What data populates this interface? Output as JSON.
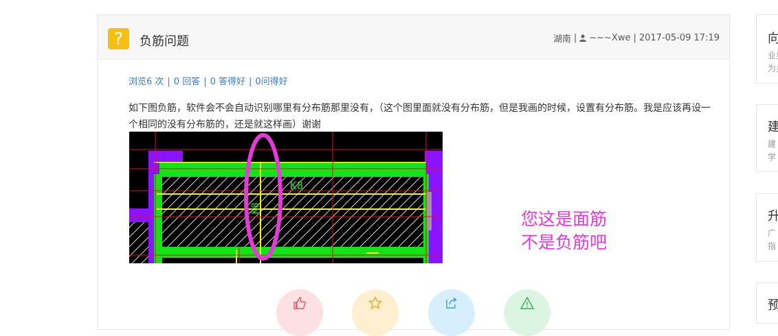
{
  "question": {
    "icon": "question-mark-icon",
    "icon_glyph": "?",
    "title": "负筋问题",
    "region": "湖南",
    "user_icon": "user-icon",
    "username": "~~~Xwe",
    "date": "2017-05-09 17:19",
    "separator": "|"
  },
  "stats": {
    "views": "浏览6 次",
    "answers": "0 回答",
    "good_answers": "0 答得好",
    "good_questions": "0问得好"
  },
  "body": "如下图负筋，软件会不会自动识别哪里有分布筋那里没有，（这个图里面就没有分布筋，但是我画的时候，设置有分布筋。我是应该再设一个相同的没有分布筋的，还是就这样画）谢谢",
  "figure": {
    "label_h": "K8",
    "label_v": "K8"
  },
  "annotation": {
    "line1": "您这是面筋",
    "line2": "不是负筋吧",
    "color": "#e43ad8"
  },
  "actions": [
    {
      "icon": "thumbs-up-icon",
      "bg": "#fde0e2",
      "color": "#e9546b"
    },
    {
      "icon": "star-icon",
      "bg": "#fdefd0",
      "color": "#f0a81a"
    },
    {
      "icon": "share-icon",
      "bg": "#d7eefc",
      "color": "#3aa0e8"
    },
    {
      "icon": "warning-icon",
      "bg": "#dcf5e2",
      "color": "#2fb34f"
    }
  ],
  "sidebar": [
    {
      "title": "向",
      "sub1": "业男",
      "sub2": "为乡"
    },
    {
      "title": "建",
      "sub1": "建",
      "sub2": "学"
    },
    {
      "title": "升",
      "sub1": "广",
      "sub2": "指"
    },
    {
      "title": "预",
      "sub1": "",
      "sub2": ""
    }
  ],
  "colors": {
    "link": "#3a79c8",
    "icon_yellow": "#f7bf14",
    "cad_green": "#13e41a",
    "cad_purple": "#8a14ff",
    "cad_yellow": "#f5f51e",
    "cad_red": "#e0101a"
  }
}
